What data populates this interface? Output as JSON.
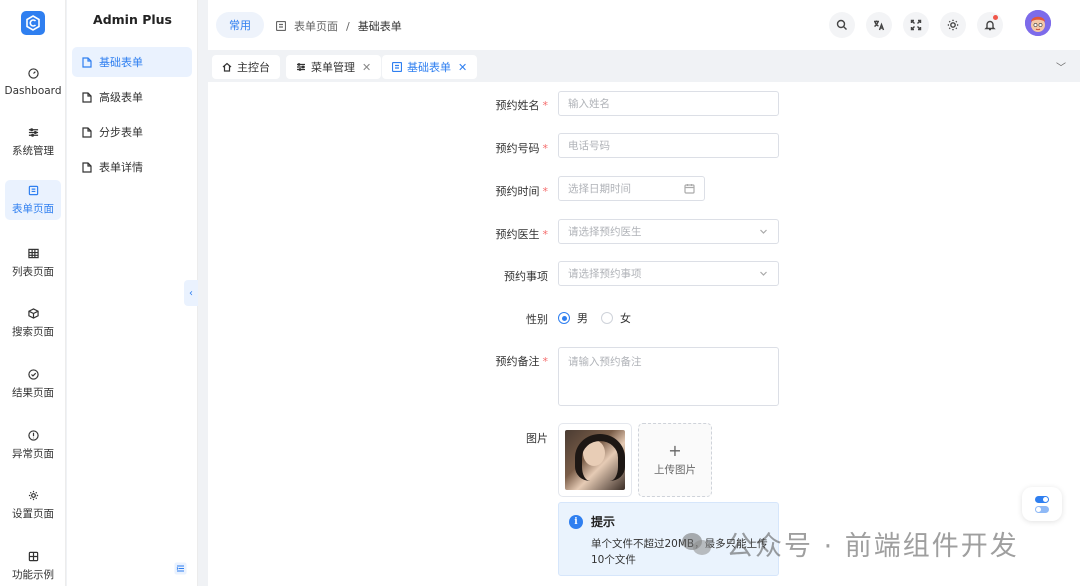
{
  "app": {
    "title": "Admin Plus"
  },
  "rail": [
    {
      "label": "Dashboard",
      "icon": "gauge-icon"
    },
    {
      "label": "系统管理",
      "icon": "sliders-icon"
    },
    {
      "label": "表单页面",
      "icon": "form-icon",
      "active": true
    },
    {
      "label": "列表页面",
      "icon": "grid-icon"
    },
    {
      "label": "搜索页面",
      "icon": "cube-icon"
    },
    {
      "label": "结果页面",
      "icon": "check-circle-icon"
    },
    {
      "label": "异常页面",
      "icon": "warning-circle-icon"
    },
    {
      "label": "设置页面",
      "icon": "gear-icon"
    },
    {
      "label": "功能示例",
      "icon": "apps-icon"
    }
  ],
  "submenu": {
    "items": [
      {
        "label": "基础表单",
        "active": true
      },
      {
        "label": "高级表单"
      },
      {
        "label": "分步表单"
      },
      {
        "label": "表单详情"
      }
    ]
  },
  "header": {
    "chip": "常用",
    "breadcrumb": {
      "parent": "表单页面",
      "separator": "/",
      "current": "基础表单"
    }
  },
  "tabs": [
    {
      "label": "主控台",
      "icon": "home-icon",
      "closable": false
    },
    {
      "label": "菜单管理",
      "icon": "sliders-icon",
      "closable": true
    },
    {
      "label": "基础表单",
      "icon": "form-icon",
      "closable": true,
      "active": true
    }
  ],
  "form": {
    "name": {
      "label": "预约姓名",
      "placeholder": "输入姓名",
      "required": true
    },
    "phone": {
      "label": "预约号码",
      "placeholder": "电话号码",
      "required": true
    },
    "time": {
      "label": "预约时间",
      "placeholder": "选择日期时间",
      "required": true
    },
    "doctor": {
      "label": "预约医生",
      "placeholder": "请选择预约医生",
      "required": true
    },
    "matter": {
      "label": "预约事项",
      "placeholder": "请选择预约事项",
      "required": false
    },
    "gender": {
      "label": "性别",
      "options": [
        "男",
        "女"
      ],
      "selected": "男"
    },
    "remark": {
      "label": "预约备注",
      "placeholder": "请输入预约备注",
      "required": true
    },
    "image": {
      "label": "图片",
      "upload_label": "上传图片"
    },
    "tip": {
      "title": "提示",
      "text": "单个文件不超过20MB，最多只能上传10个文件"
    },
    "required_mark": "*"
  },
  "watermark": {
    "text": "公众号 · 前端组件开发"
  },
  "colors": {
    "accent": "#2f7ff0",
    "required": "#f56c6c",
    "active_bg": "#eaf2fe"
  }
}
